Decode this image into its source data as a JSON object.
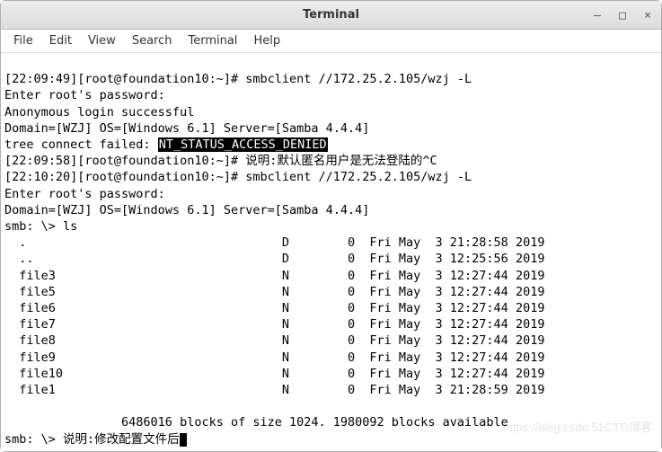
{
  "window": {
    "title": "Terminal"
  },
  "menu": {
    "file": "File",
    "edit": "Edit",
    "view": "View",
    "search": "Search",
    "terminal": "Terminal",
    "help": "Help"
  },
  "lines": {
    "l1": "[22:09:49][root@foundation10:~]# smbclient //172.25.2.105/wzj -L",
    "l2": "Enter root's password:",
    "l3": "Anonymous login successful",
    "l4": "Domain=[WZJ] OS=[Windows 6.1] Server=[Samba 4.4.4]",
    "l5a": "tree connect failed: ",
    "l5b": "NT_STATUS_ACCESS_DENIED",
    "l6": "[22:09:58][root@foundation10:~]# 说明:默认匿名用户是无法登陆的^C",
    "l7": "[22:10:20][root@foundation10:~]# smbclient //172.25.2.105/wzj -L",
    "l8": "Enter root's password:",
    "l9": "Domain=[WZJ] OS=[Windows 6.1] Server=[Samba 4.4.4]",
    "l10": "smb: \\> ls",
    "l11": "  .                                   D        0  Fri May  3 21:28:58 2019",
    "l12": "  ..                                  D        0  Fri May  3 12:25:56 2019",
    "l13": "  file3                               N        0  Fri May  3 12:27:44 2019",
    "l14": "  file5                               N        0  Fri May  3 12:27:44 2019",
    "l15": "  file6                               N        0  Fri May  3 12:27:44 2019",
    "l16": "  file7                               N        0  Fri May  3 12:27:44 2019",
    "l17": "  file8                               N        0  Fri May  3 12:27:44 2019",
    "l18": "  file9                               N        0  Fri May  3 12:27:44 2019",
    "l19": "  file10                              N        0  Fri May  3 12:27:44 2019",
    "l20": "  file1                               N        0  Fri May  3 21:28:59 2019",
    "l21": "",
    "l22": "                6486016 blocks of size 1024. 1980092 blocks available",
    "l23": "smb: \\> 说明:修改配置文件后"
  },
  "watermark": "https://blog.csdn 51CTO博客"
}
